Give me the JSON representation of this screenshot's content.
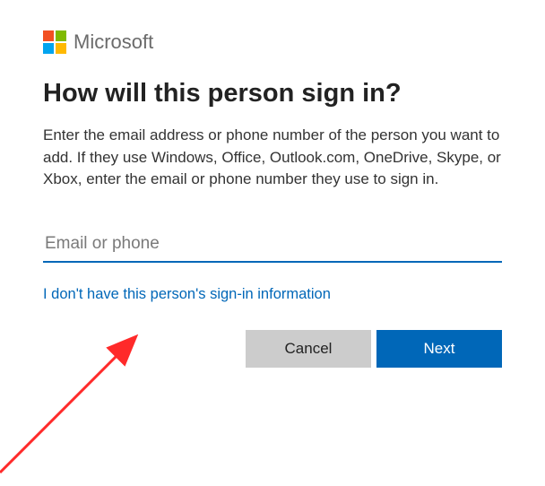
{
  "header": {
    "brand": "Microsoft"
  },
  "title": "How will this person sign in?",
  "description": "Enter the email address or phone number of the person you want to add. If they use Windows, Office, Outlook.com, OneDrive, Skype, or Xbox, enter the email or phone number they use to sign in.",
  "input": {
    "placeholder": "Email or phone",
    "value": ""
  },
  "link_text": "I don't have this person's sign-in information",
  "buttons": {
    "cancel": "Cancel",
    "next": "Next"
  },
  "colors": {
    "accent": "#0067b8"
  }
}
